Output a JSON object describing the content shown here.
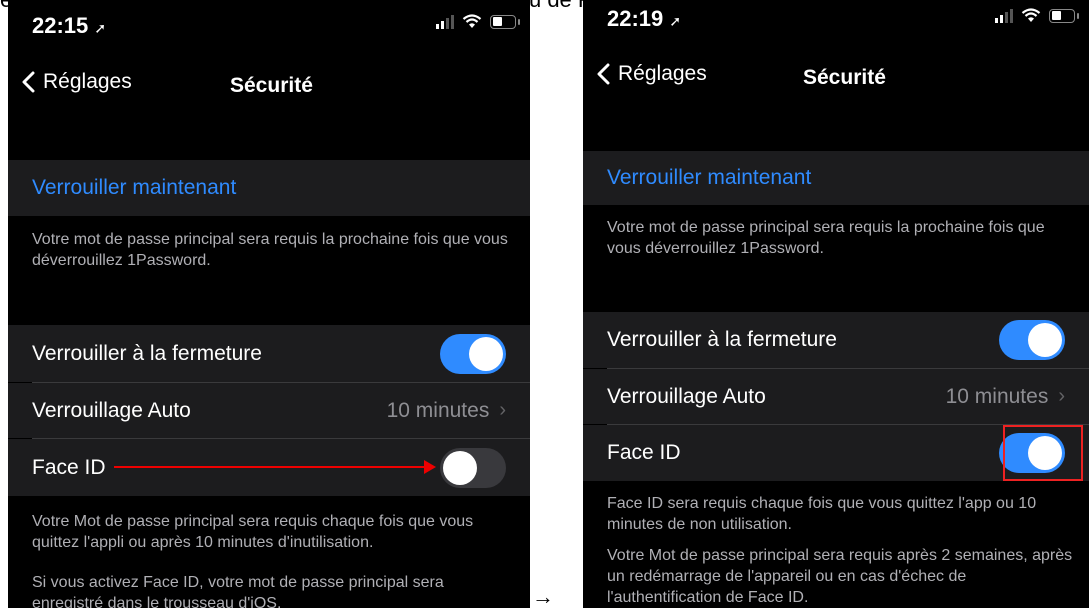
{
  "caption": "ensuite qu'à mettre l'interrupteur à droite de TouchID ou de FaceID en position « active ».",
  "arrow_between": "→",
  "left": {
    "status": {
      "time": "22:15",
      "location_glyph": "➚"
    },
    "nav": {
      "back_label": "Réglages",
      "title": "Sécurité"
    },
    "lock_now": "Verrouiller maintenant",
    "lock_now_footer": "Votre mot de passe principal sera requis la prochaine fois que vous déverrouillez 1Password.",
    "lock_on_close": {
      "label": "Verrouiller à la fermeture",
      "state": "on"
    },
    "auto_lock": {
      "label": "Verrouillage Auto",
      "value": "10 minutes",
      "chevron": "›"
    },
    "face_id": {
      "label": "Face ID",
      "state": "off"
    },
    "footer1": "Votre Mot de passe principal sera requis chaque fois que vous quittez l'appli ou après 10 minutes d'inutilisation.",
    "footer2": "Si vous activez Face ID, votre mot de passe principal sera enregistré dans le trousseau d'iOS."
  },
  "right": {
    "status": {
      "time": "22:19",
      "location_glyph": "➚"
    },
    "nav": {
      "back_label": "Réglages",
      "title": "Sécurité"
    },
    "lock_now": "Verrouiller maintenant",
    "lock_now_footer": "Votre mot de passe principal sera requis la prochaine fois que vous déverrouillez 1Password.",
    "lock_on_close": {
      "label": "Verrouiller à la fermeture",
      "state": "on"
    },
    "auto_lock": {
      "label": "Verrouillage Auto",
      "value": "10 minutes",
      "chevron": "›"
    },
    "face_id": {
      "label": "Face ID",
      "state": "on"
    },
    "footer1": "Face ID sera requis chaque fois que vous quittez l'app ou 10 minutes de non utilisation.",
    "footer2": "Votre Mot de passe principal sera requis après 2 semaines, après un redémarrage de l'appareil ou en cas d'échec de l'authentification de Face ID."
  },
  "colors": {
    "accent": "#2f8bff",
    "highlight": "#e22222",
    "annotation_arrow": "#e00000"
  },
  "icons": [
    "chevron-left-icon",
    "location-arrow-icon",
    "signal-icon",
    "wifi-icon",
    "battery-icon"
  ]
}
